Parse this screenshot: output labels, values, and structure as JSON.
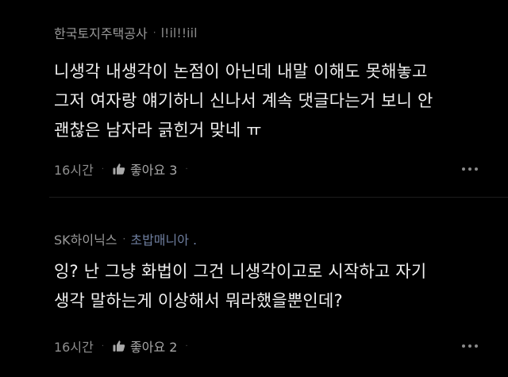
{
  "comments": [
    {
      "author": "한국토지주택공사",
      "tag": "l!il!!iil",
      "lines": [
        "니생각 내생각이 논점이 아닌데 내말 이해도 못해놓고",
        "그저 여자랑 얘기하니 신나서 계속 댓글다는거 보니 안",
        "괜찮은 남자라 긁힌거 맞네 ㅠ"
      ],
      "time": "16시간",
      "like_label": "좋아요 3"
    },
    {
      "author": "SK하이닉스",
      "tag": "초밥매니아 .",
      "lines": [
        "잉? 난 그냥 화법이 그건 니생각이고로 시작하고 자기",
        "생각 말하는게 이상해서 뭐라했을뿐인데?"
      ],
      "time": "16시간",
      "like_label": "좋아요 2"
    }
  ],
  "icons": {
    "like": "thumbs-up-icon",
    "more": "more-horizontal-icon"
  },
  "colors": {
    "background": "#000000",
    "text": "#f0f0f0",
    "meta": "#9a9a9a"
  }
}
